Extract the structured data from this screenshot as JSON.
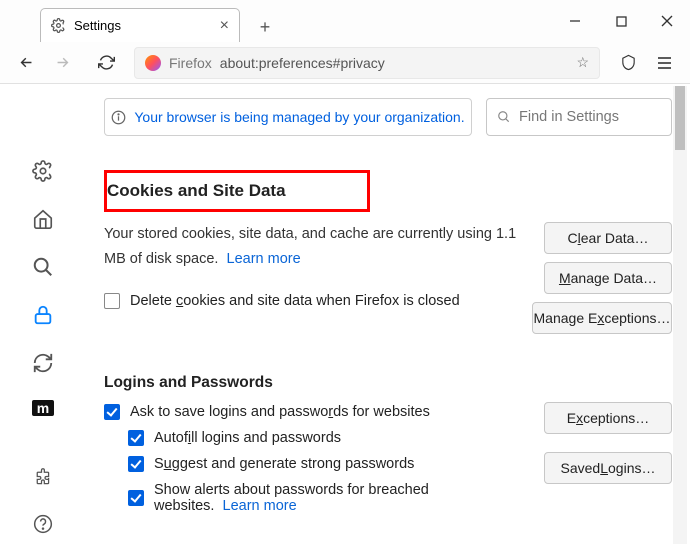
{
  "tab": {
    "title": "Settings"
  },
  "urlbar": {
    "brand": "Firefox",
    "url": "about:preferences#privacy"
  },
  "notice": "Your browser is being managed by your organization.",
  "search_placeholder": "Find in Settings",
  "cookies": {
    "heading": "Cookies and Site Data",
    "desc_a": "Your stored cookies, site data, and cache are currently using 1.1 MB of disk space.",
    "learn": "Learn more",
    "delete": "Delete cookies and site data when Firefox is closed",
    "btn_clear": "Clear Data…",
    "btn_manage": "Manage Data…",
    "btn_except": "Manage Exceptions…"
  },
  "logins": {
    "heading": "Logins and Passwords",
    "ask": "Ask to save logins and passwords for websites",
    "autofill": "Autofill logins and passwords",
    "suggest": "Suggest and generate strong passwords",
    "breach": "Show alerts about passwords for breached websites.",
    "learn": "Learn more",
    "btn_except": "Exceptions…",
    "btn_saved": "Saved Logins…"
  }
}
